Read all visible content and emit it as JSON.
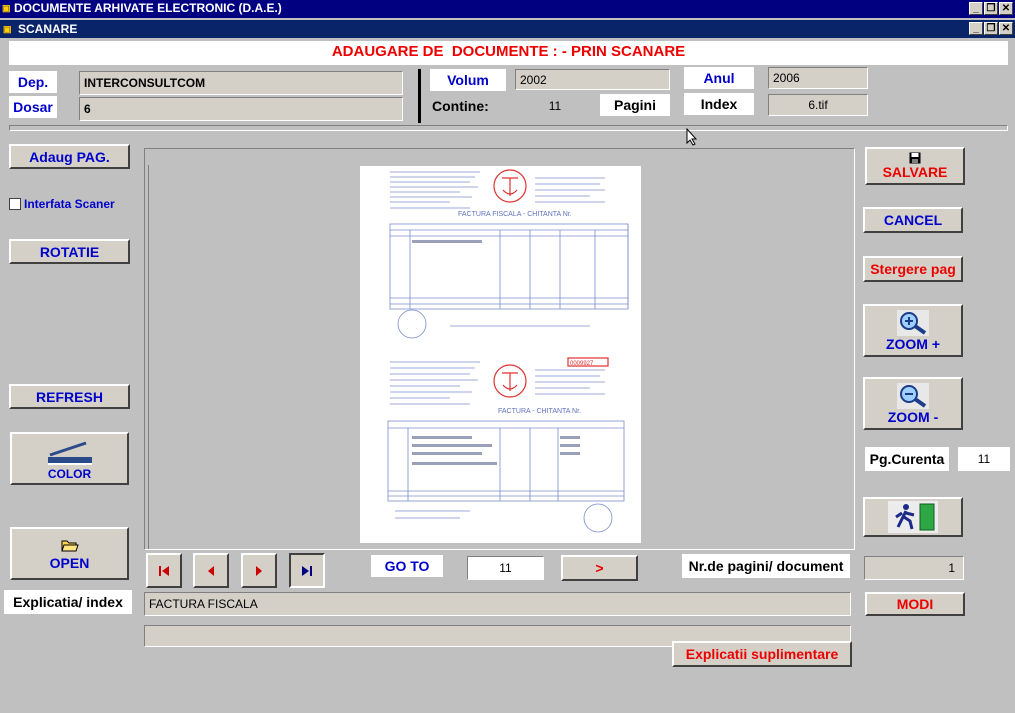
{
  "app_title": "DOCUMENTE ARHIVATE ELECTRONIC (D.A.E.)",
  "window_title": "SCANARE",
  "window_controls": [
    "_",
    "❐",
    "✕"
  ],
  "header": "ADAUGARE DE  DOCUMENTE : - PRIN SCANARE",
  "fields": {
    "dep_label": "Dep.",
    "dep_value": "INTERCONSULTCOM",
    "dosar_label": "Dosar",
    "dosar_value": "6",
    "volum_label": "Volum",
    "volum_value": "2002",
    "anul_label": "Anul",
    "anul_value": "2006",
    "contine_label": "Contine:",
    "contine_value": "11",
    "pagini_label": "Pagini",
    "index_label": "Index",
    "index_value": "6.tif"
  },
  "left_panel": {
    "add_page": "Adaug PAG.",
    "scanner_interface": "Interfata Scaner",
    "rotate": "ROTATIE",
    "refresh": "REFRESH",
    "color": "COLOR",
    "open": "OPEN",
    "explanation_label": "Explicatia/ index"
  },
  "right_panel": {
    "save": "SALVARE",
    "cancel": "CANCEL",
    "delete_page": "Stergere pag",
    "zoom_in": "ZOOM +",
    "zoom_out": "ZOOM -",
    "current_page_label": "Pg.Curenta",
    "current_page_value": "11",
    "modify": "MODI",
    "pages_per_doc_value": "1"
  },
  "navigation": {
    "goto_label": "GO TO",
    "goto_value": "11",
    "go_button": ">",
    "pages_per_doc_label": "Nr.de pagini/ document"
  },
  "explanation_value": "FACTURA FISCALA",
  "extra_explanations": "Explicatii suplimentare",
  "doc_preview": {
    "invoice1_title": "FACTURA FISCALA - CHITANTA Nr.",
    "invoice2_title": "FACTURA - CHITANTA Nr.",
    "invoice_number": "0009927",
    "page_number": "1"
  },
  "colors": {
    "title_bar": "#000080",
    "header_text": "#ee0000",
    "button_text": "#0000cc",
    "danger_text": "#ee0000",
    "background": "#c0c0c0"
  }
}
